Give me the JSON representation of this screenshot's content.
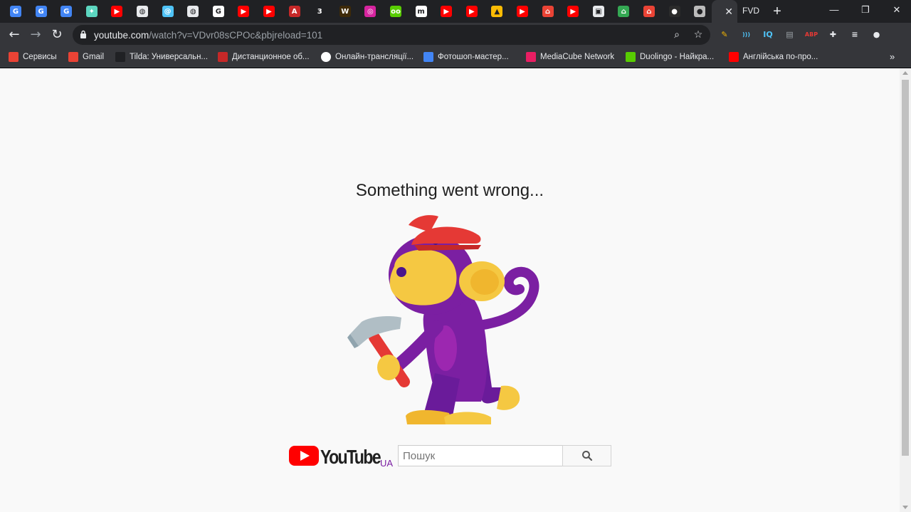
{
  "browser": {
    "active_tab_text": "FVD",
    "new_tab_label": "+",
    "window_controls": [
      "—",
      "❐",
      "✕"
    ],
    "url": {
      "host": "youtube.com",
      "path": "/watch?v=VDvr08sCPOc&pbjreload=101"
    },
    "tab_favicons": [
      {
        "name": "google-translate-icon",
        "color": "#4285f4",
        "glyph": "G"
      },
      {
        "name": "google-translate-icon",
        "color": "#4285f4",
        "glyph": "G"
      },
      {
        "name": "google-translate-icon",
        "color": "#4285f4",
        "glyph": "G"
      },
      {
        "name": "lightbulb-icon",
        "color": "#5cd6c0",
        "glyph": "✦"
      },
      {
        "name": "youtube-icon",
        "color": "#ff0000",
        "glyph": "▶"
      },
      {
        "name": "globe-icon",
        "color": "#e8eaed",
        "glyph": "◍"
      },
      {
        "name": "at-icon",
        "color": "#4fc3f7",
        "glyph": "@"
      },
      {
        "name": "globe-icon",
        "color": "#e8eaed",
        "glyph": "◍"
      },
      {
        "name": "google-icon",
        "color": "#ffffff",
        "glyph": "G"
      },
      {
        "name": "youtube-icon",
        "color": "#ff0000",
        "glyph": "▶"
      },
      {
        "name": "youtube-icon",
        "color": "#ff0000",
        "glyph": "▶"
      },
      {
        "name": "adobe-icon",
        "color": "#c62828",
        "glyph": "A"
      },
      {
        "name": "number-three-icon",
        "color": "#202124",
        "glyph": "3"
      },
      {
        "name": "w-badge-icon",
        "color": "#3e2a08",
        "glyph": "W"
      },
      {
        "name": "instagram-icon",
        "color": "#d6249f",
        "glyph": "◎"
      },
      {
        "name": "duolingo-icon",
        "color": "#58cc02",
        "glyph": "oo"
      },
      {
        "name": "m-icon",
        "color": "#ffffff",
        "glyph": "m"
      },
      {
        "name": "youtube-icon",
        "color": "#ff0000",
        "glyph": "▶"
      },
      {
        "name": "youtube-icon",
        "color": "#ff0000",
        "glyph": "▶"
      },
      {
        "name": "google-drive-icon",
        "color": "#fbbc04",
        "glyph": "▲"
      },
      {
        "name": "youtube-icon",
        "color": "#ff0000",
        "glyph": "▶"
      },
      {
        "name": "home-icon",
        "color": "#ea4335",
        "glyph": "⌂"
      },
      {
        "name": "youtube-icon",
        "color": "#ff0000",
        "glyph": "▶"
      },
      {
        "name": "document-icon",
        "color": "#e8eaed",
        "glyph": "▣"
      },
      {
        "name": "home-icon",
        "color": "#34a853",
        "glyph": "⌂"
      },
      {
        "name": "home-icon",
        "color": "#ea4335",
        "glyph": "⌂"
      },
      {
        "name": "dark-circle-icon",
        "color": "#2b2b2b",
        "glyph": "●"
      },
      {
        "name": "github-icon",
        "color": "#bbbbbb",
        "glyph": "●"
      }
    ],
    "extensions": [
      {
        "name": "pencil-extension-icon",
        "color": "#f4b400",
        "glyph": "✎"
      },
      {
        "name": "wifi-extension-icon",
        "color": "#4fc3f7",
        "glyph": ")))"
      },
      {
        "name": "iq-extension-icon",
        "color": "#4fc3f7",
        "glyph": "IQ"
      },
      {
        "name": "new-extension-icon",
        "color": "#9aa0a6",
        "glyph": "▤"
      },
      {
        "name": "abp-extension-icon",
        "color": "#e53935",
        "glyph": "ABP"
      },
      {
        "name": "puzzle-extension-icon",
        "color": "#e8eaed",
        "glyph": "✚"
      },
      {
        "name": "media-queue-icon",
        "color": "#e8eaed",
        "glyph": "≡"
      },
      {
        "name": "profile-avatar-icon",
        "color": "#e8eaed",
        "glyph": "●"
      }
    ],
    "bookmarks": [
      {
        "label": "Сервисы",
        "name": "apps-grid-icon",
        "color": "#ea4335"
      },
      {
        "label": "Gmail",
        "name": "gmail-icon",
        "color": "#ea4335"
      },
      {
        "label": "Tilda: Универсальн...",
        "name": "tilda-icon",
        "color": "#202124"
      },
      {
        "label": "Дистанционное об...",
        "name": "adobe-icon",
        "color": "#c62828"
      },
      {
        "label": "Онлайн-трансляції...",
        "name": "circle-icon",
        "color": "#ffffff"
      },
      {
        "label": "Фотошоп-мастер...",
        "name": "photoshop-icon",
        "color": "#4285f4"
      },
      {
        "label": "MediaCube Network",
        "name": "mediacube-icon",
        "color": "#e91e63"
      },
      {
        "label": "Duolingo - Найкра...",
        "name": "duolingo-icon",
        "color": "#58cc02"
      },
      {
        "label": "Англійська по-про...",
        "name": "youtube-icon",
        "color": "#ff0000"
      }
    ],
    "bookmarks_more": "»"
  },
  "page": {
    "error_title": "Something went wrong...",
    "logo_text": "YouTube",
    "logo_region": "UA",
    "search_placeholder": "Пошук",
    "brand_red": "#ff0000",
    "monkey_purple": "#7b1fa2",
    "monkey_yellow": "#f5c842"
  }
}
